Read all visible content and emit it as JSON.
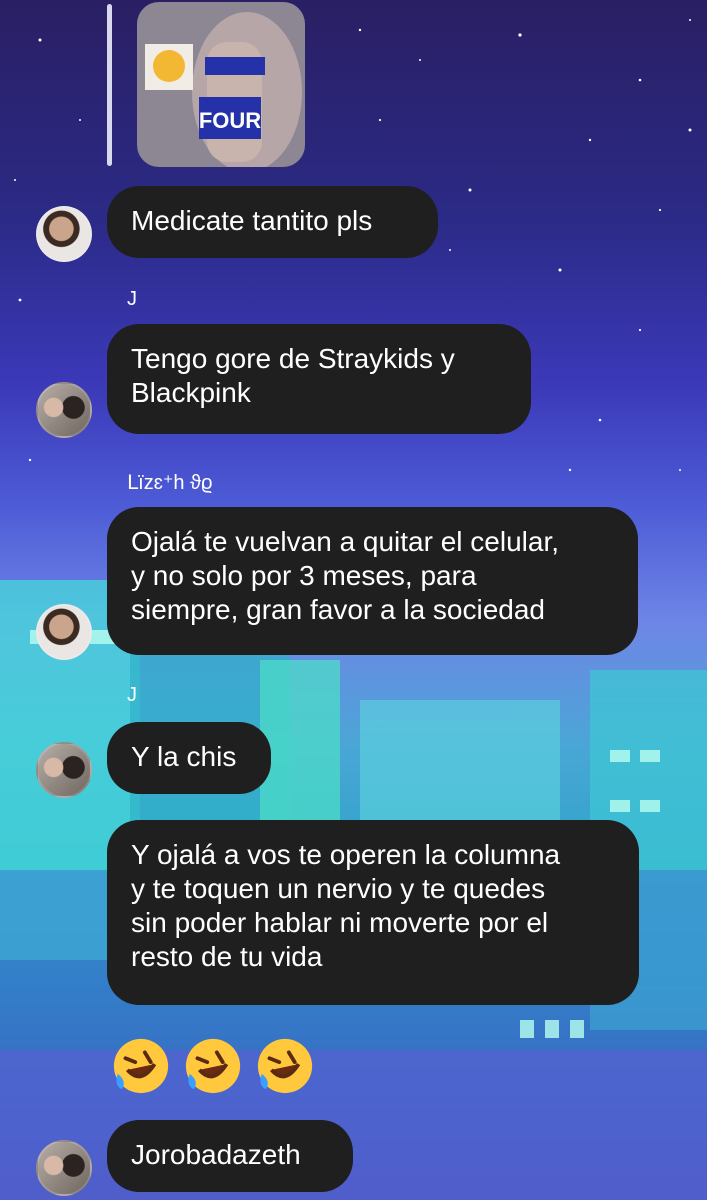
{
  "reply_preview": {
    "image_text": "FOUR"
  },
  "messages": [
    {
      "text": "Medicate tantito pls"
    },
    {
      "sender": "J",
      "text": "Tengo gore de Straykids y\nBlackpink"
    },
    {
      "sender": "ᒪïzɛ⁺h ϑϱ",
      "text": "Ojalá te vuelvan a quitar el celular,\ny no solo por 3 meses, para\nsiempre, gran favor a la sociedad"
    },
    {
      "sender": "J",
      "text": "Y la chis"
    },
    {
      "text": "Y ojalá a vos te operen la columna\ny te toquen un nervio y te quedes\nsin poder hablar ni moverte por el\nresto de tu vida"
    },
    {
      "reaction": "🤣🤣🤣",
      "emoji_name": "rolling-on-floor-laughing"
    },
    {
      "text": "Jorobadazeth"
    }
  ],
  "colors": {
    "bubble": "#1f1f1f",
    "text": "#ffffff"
  }
}
